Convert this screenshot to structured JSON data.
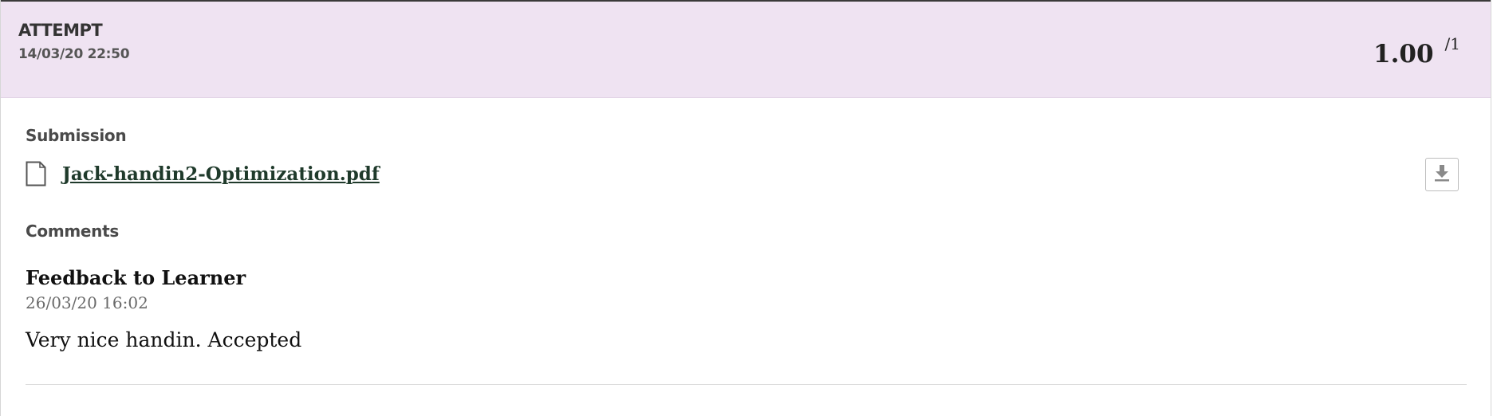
{
  "attempt": {
    "label": "ATTEMPT",
    "date": "14/03/20 22:50",
    "score": "1.00",
    "score_max": "/1"
  },
  "submission": {
    "title": "Submission",
    "file_name": "Jack-handin2-Optimization.pdf",
    "file_icon": "document-icon",
    "download_icon": "download-icon"
  },
  "comments": {
    "title": "Comments",
    "feedback": {
      "heading": "Feedback to Learner",
      "date": "26/03/20 16:02",
      "text": "Very nice handin. Accepted"
    }
  },
  "colors": {
    "header_bg": "#efe3f2",
    "link": "#1f3a2b"
  }
}
